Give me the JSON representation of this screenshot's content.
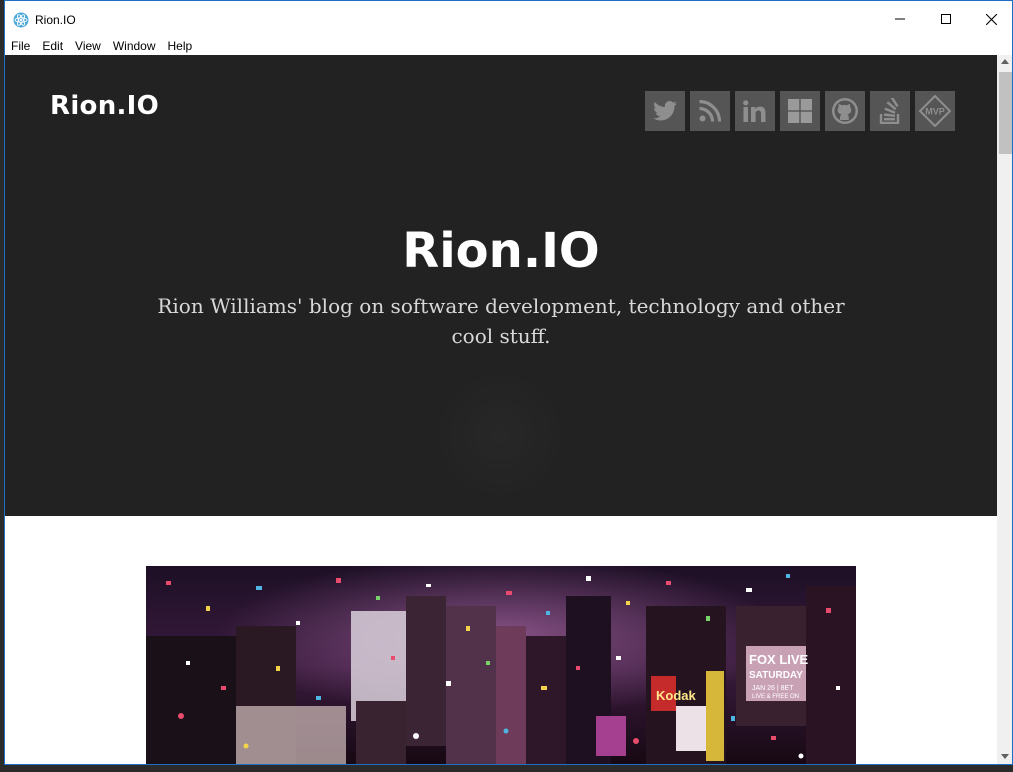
{
  "window": {
    "title": "Rion.IO",
    "controls": {
      "minimize_icon": "minimize-icon",
      "maximize_icon": "maximize-icon",
      "close_icon": "close-icon"
    }
  },
  "menu": {
    "items": [
      {
        "label": "File"
      },
      {
        "label": "Edit"
      },
      {
        "label": "View"
      },
      {
        "label": "Window"
      },
      {
        "label": "Help"
      }
    ]
  },
  "header": {
    "brand": "Rion.IO",
    "social_links": [
      {
        "icon": "twitter-icon"
      },
      {
        "icon": "rss-icon"
      },
      {
        "icon": "linkedin-icon"
      },
      {
        "icon": "windows-icon"
      },
      {
        "icon": "github-icon"
      },
      {
        "icon": "stackoverflow-icon"
      },
      {
        "icon": "mvp-icon",
        "label": "MVP"
      }
    ]
  },
  "hero": {
    "title": "Rion.IO",
    "subtitle": "Rion Williams' blog on software development, technology and other cool stuff."
  },
  "post": {
    "image_description_icon": "photo-icon",
    "image_signs": [
      "Kodak",
      "FOX LIVE",
      "SATURDAY",
      "JAN 26 | 8ET",
      "LIVE & FREE ON"
    ]
  },
  "colors": {
    "hero_background": "#222222",
    "social_button": "#555555",
    "window_border": "#1e6fc6"
  }
}
